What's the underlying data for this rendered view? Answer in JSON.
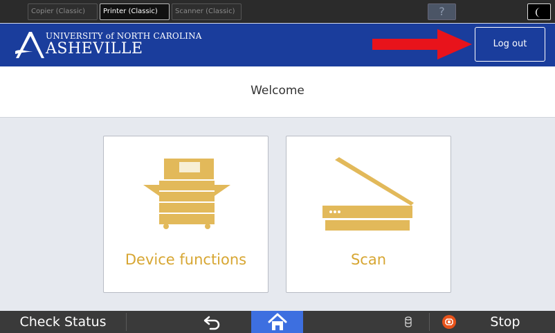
{
  "topbar": {
    "tabs": [
      {
        "label": "Copier (Classic)",
        "active": false
      },
      {
        "label": "Printer (Classic)",
        "active": true
      },
      {
        "label": "Scanner (Classic)",
        "active": false
      }
    ],
    "help_label": "?"
  },
  "banner": {
    "logo_line1": "UNIVERSITY of NORTH CAROLINA",
    "logo_line2": "ASHEVILLE",
    "logout_label": "Log out",
    "arrow_color": "#e8131b"
  },
  "welcome": {
    "text": "Welcome"
  },
  "tiles": [
    {
      "label": "Device functions",
      "icon": "copier-icon"
    },
    {
      "label": "Scan",
      "icon": "scanner-icon"
    }
  ],
  "bottombar": {
    "check_status_label": "Check Status",
    "stop_label": "Stop"
  },
  "colors": {
    "brand_blue": "#1a3d9c",
    "accent_gold": "#d7a632",
    "alert_red": "#e8131b"
  }
}
